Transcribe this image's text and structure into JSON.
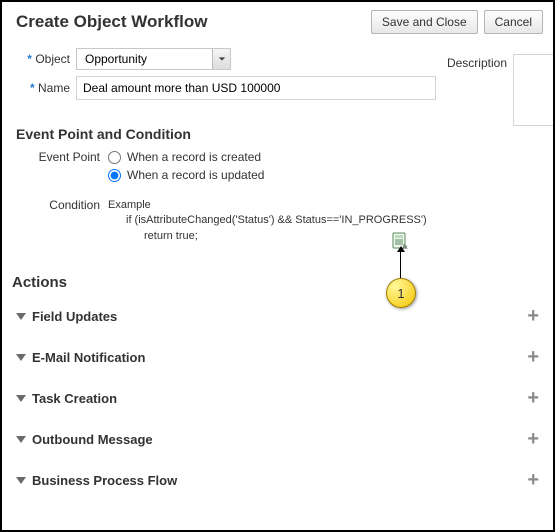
{
  "header": {
    "title": "Create Object Workflow",
    "save_label": "Save and Close",
    "cancel_label": "Cancel"
  },
  "form": {
    "object_label": "Object",
    "object_value": "Opportunity",
    "name_label": "Name",
    "name_value": "Deal amount more than USD 100000",
    "description_label": "Description"
  },
  "event_section": {
    "heading": "Event Point and Condition",
    "ep_label": "Event Point",
    "option_created": "When a record is created",
    "option_updated": "When a record is updated",
    "selected": "updated",
    "cond_label": "Condition",
    "example_label": "Example",
    "example_line1": "if (isAttributeChanged('Status') && Status=='IN_PROGRESS')",
    "example_line2": "return true;"
  },
  "callout_number": "1",
  "actions": {
    "heading": "Actions",
    "items": [
      {
        "label": "Field Updates"
      },
      {
        "label": "E-Mail Notification"
      },
      {
        "label": "Task Creation"
      },
      {
        "label": "Outbound Message"
      },
      {
        "label": "Business Process Flow"
      }
    ]
  }
}
